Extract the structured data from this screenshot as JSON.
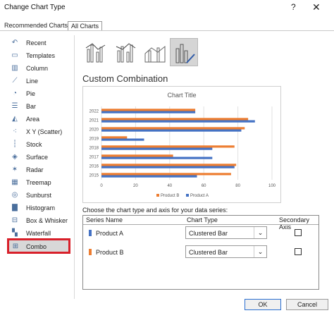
{
  "window": {
    "title": "Change Chart Type",
    "help": "?",
    "close": "✕"
  },
  "tabs": [
    {
      "label": "Recommended Charts"
    },
    {
      "label": "All Charts"
    }
  ],
  "sidebar": {
    "items": [
      {
        "label": "Recent",
        "icon": "recent-icon"
      },
      {
        "label": "Templates",
        "icon": "templates-icon"
      },
      {
        "label": "Column",
        "icon": "column-chart-icon"
      },
      {
        "label": "Line",
        "icon": "line-chart-icon"
      },
      {
        "label": "Pie",
        "icon": "pie-chart-icon"
      },
      {
        "label": "Bar",
        "icon": "bar-chart-icon"
      },
      {
        "label": "Area",
        "icon": "area-chart-icon"
      },
      {
        "label": "X Y (Scatter)",
        "icon": "scatter-chart-icon"
      },
      {
        "label": "Stock",
        "icon": "stock-chart-icon"
      },
      {
        "label": "Surface",
        "icon": "surface-chart-icon"
      },
      {
        "label": "Radar",
        "icon": "radar-chart-icon"
      },
      {
        "label": "Treemap",
        "icon": "treemap-chart-icon"
      },
      {
        "label": "Sunburst",
        "icon": "sunburst-chart-icon"
      },
      {
        "label": "Histogram",
        "icon": "histogram-chart-icon"
      },
      {
        "label": "Box & Whisker",
        "icon": "box-whisker-chart-icon"
      },
      {
        "label": "Waterfall",
        "icon": "waterfall-chart-icon"
      },
      {
        "label": "Combo",
        "icon": "combo-chart-icon",
        "selected": true
      }
    ]
  },
  "section_title": "Custom Combination",
  "chart_data": {
    "type": "bar",
    "title": "Chart Title",
    "categories": [
      "2015",
      "2016",
      "2017",
      "2018",
      "2019",
      "2020",
      "2021",
      "2022"
    ],
    "series": [
      {
        "name": "Product B",
        "color": "#ED7D31",
        "values": [
          76,
          79,
          42,
          78,
          15,
          84,
          86,
          55
        ]
      },
      {
        "name": "Product A",
        "color": "#4472C4",
        "values": [
          56,
          78,
          65,
          65,
          25,
          82,
          90,
          55
        ]
      }
    ],
    "xlim": [
      0,
      100
    ],
    "xticks": [
      "0",
      "20",
      "40",
      "60",
      "80",
      "100"
    ],
    "grid": true,
    "legend": "bottom"
  },
  "series_panel": {
    "prompt": "Choose the chart type and axis for your data series:",
    "headers": {
      "name": "Series Name",
      "type": "Chart Type",
      "axis": "Secondary Axis"
    },
    "rows": [
      {
        "name": "Product A",
        "color": "#4472C4",
        "chart_type": "Clustered Bar",
        "secondary": false
      },
      {
        "name": "Product B",
        "color": "#ED7D31",
        "chart_type": "Clustered Bar",
        "secondary": false
      }
    ]
  },
  "buttons": {
    "ok": "OK",
    "cancel": "Cancel"
  }
}
